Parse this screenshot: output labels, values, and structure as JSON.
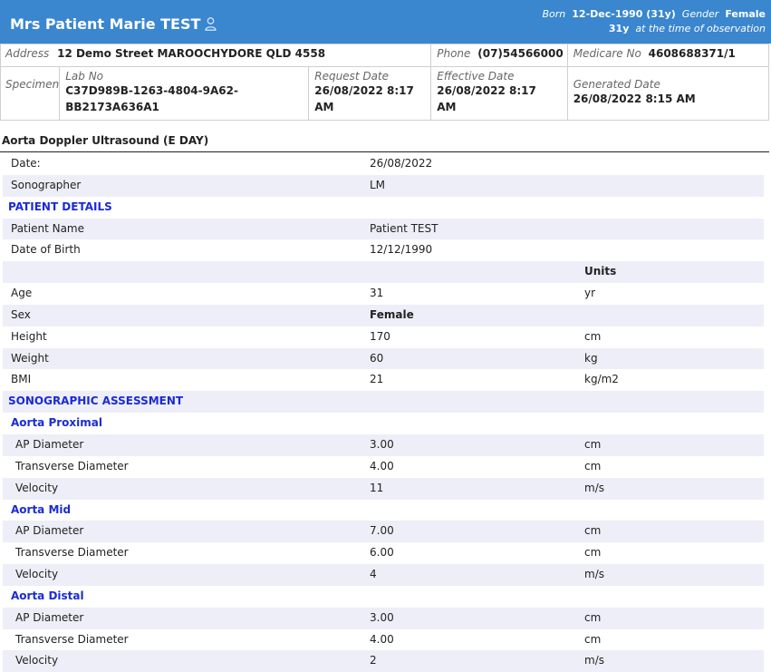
{
  "patient": {
    "name": "Mrs Patient Marie TEST",
    "born_label": "Born",
    "born_value": "12-Dec-1990 (31y)",
    "gender_label": "Gender",
    "gender_value": "Female",
    "age_value": "31y",
    "age_note": "at the time of observation"
  },
  "demographics": {
    "address_label": "Address",
    "address_value": "12 Demo Street MAROOCHYDORE QLD 4558",
    "phone_label": "Phone",
    "phone_value": "(07)54566000",
    "medicare_label": "Medicare No",
    "medicare_value": "4608688371/1",
    "specimen_label": "Specimen",
    "labno_label": "Lab No",
    "labno_line1": "C37D989B-1263-4804-9A62-",
    "labno_line2": "BB2173A636A1",
    "request_label": "Request Date",
    "request_line1": "26/08/2022 8:17",
    "request_line2": "AM",
    "effective_label": "Effective Date",
    "effective_line1": "26/08/2022 8:17",
    "effective_line2": "AM",
    "generated_label": "Generated Date",
    "generated_value": "26/08/2022 8:15 AM"
  },
  "report": {
    "title": "Aorta Doppler Ultrasound (E DAY)",
    "rows": [
      {
        "type": "row",
        "label": "Date:",
        "value": "26/08/2022",
        "unit": ""
      },
      {
        "type": "row",
        "label": "Sonographer",
        "value": "LM",
        "unit": ""
      },
      {
        "type": "section",
        "label": "PATIENT DETAILS"
      },
      {
        "type": "row",
        "label": "Patient Name",
        "value": "Patient TEST",
        "unit": ""
      },
      {
        "type": "row",
        "label": "Date of Birth",
        "value": "12/12/1990",
        "unit": ""
      },
      {
        "type": "row",
        "label": "",
        "value": "",
        "unit": "Units",
        "unit_bold": true
      },
      {
        "type": "row",
        "label": "Age",
        "value": "31",
        "unit": "yr"
      },
      {
        "type": "row",
        "label": "Sex",
        "value": "Female",
        "unit": "",
        "value_bold": true
      },
      {
        "type": "row",
        "label": "Height",
        "value": "170",
        "unit": "cm"
      },
      {
        "type": "row",
        "label": "Weight",
        "value": "60",
        "unit": "kg"
      },
      {
        "type": "row",
        "label": "BMI",
        "value": "21",
        "unit": "kg/m2"
      },
      {
        "type": "section",
        "label": "SONOGRAPHIC ASSESSMENT"
      },
      {
        "type": "sub",
        "label": "Aorta Proximal"
      },
      {
        "type": "row",
        "label": "AP Diameter",
        "value": "3.00",
        "unit": "cm",
        "indent": true
      },
      {
        "type": "row",
        "label": "Transverse Diameter",
        "value": "4.00",
        "unit": "cm",
        "indent": true
      },
      {
        "type": "row",
        "label": "Velocity",
        "value": "11",
        "unit": "m/s",
        "indent": true
      },
      {
        "type": "sub",
        "label": "Aorta Mid"
      },
      {
        "type": "row",
        "label": "AP Diameter",
        "value": "7.00",
        "unit": "cm",
        "indent": true
      },
      {
        "type": "row",
        "label": "Transverse Diameter",
        "value": "6.00",
        "unit": "cm",
        "indent": true
      },
      {
        "type": "row",
        "label": "Velocity",
        "value": "4",
        "unit": "m/s",
        "indent": true
      },
      {
        "type": "sub",
        "label": "Aorta Distal"
      },
      {
        "type": "row",
        "label": "AP Diameter",
        "value": "3.00",
        "unit": "cm",
        "indent": true
      },
      {
        "type": "row",
        "label": "Transverse Diameter",
        "value": "4.00",
        "unit": "cm",
        "indent": true
      },
      {
        "type": "row",
        "label": "Velocity",
        "value": "2",
        "unit": "m/s",
        "indent": true
      }
    ]
  }
}
